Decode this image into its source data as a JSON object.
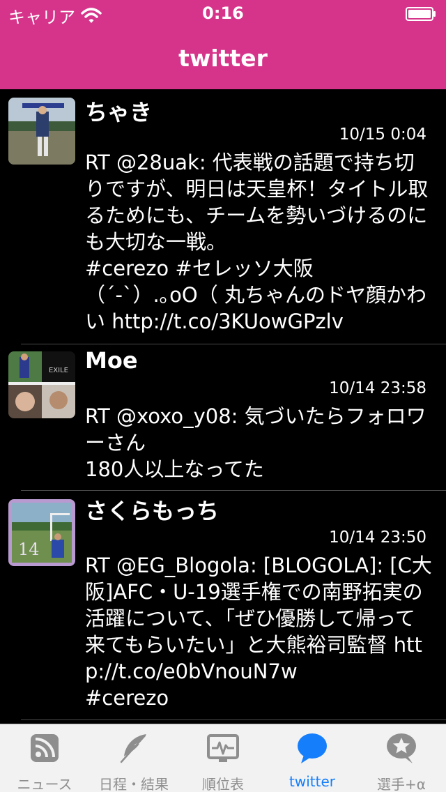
{
  "status_bar": {
    "carrier": "キャリア",
    "time": "0:16",
    "wifi_icon": "wifi-icon",
    "battery_icon": "battery-icon"
  },
  "nav": {
    "title": "twitter"
  },
  "tweets": [
    {
      "name": "ちゃき",
      "time": "10/15 0:04",
      "text": "RT @28uak: 代表戦の話題で持ち切りですが、明日は天皇杯！タイトル取るためにも、チームを勢いづけるのにも大切な一戦。\n#cerezo #セレッソ大阪\n（´-`）.｡oO（ 丸ちゃんのドヤ顔かわい http://t.co/3KUowGPzlv"
    },
    {
      "name": "Moe",
      "time": "10/14 23:58",
      "text": "RT @xoxo_y08: 気づいたらフォロワーさん\n180人以上なってた"
    },
    {
      "name": "さくらもっち",
      "time": "10/14 23:50",
      "text": "RT @EG_Blogola: [BLOGOLA]: [C大阪]AFC・U-19選手権での南野拓実の活躍について、「ぜひ優勝して帰って来てもらいたい」と大熊裕司監督 http://t.co/e0bVnouN7w\n#cerezo"
    }
  ],
  "tabs": [
    {
      "label": "ニュース",
      "icon": "rss-icon"
    },
    {
      "label": "日程・結果",
      "icon": "feather-icon"
    },
    {
      "label": "順位表",
      "icon": "monitor-icon"
    },
    {
      "label": "twitter",
      "icon": "speech-bubble-icon",
      "active": true
    },
    {
      "label": "選手+α",
      "icon": "star-bubble-icon"
    }
  ],
  "colors": {
    "brand": "#d6348a",
    "background": "#000000",
    "tab_active": "#157efb",
    "tab_inactive": "#8e8e8e"
  }
}
